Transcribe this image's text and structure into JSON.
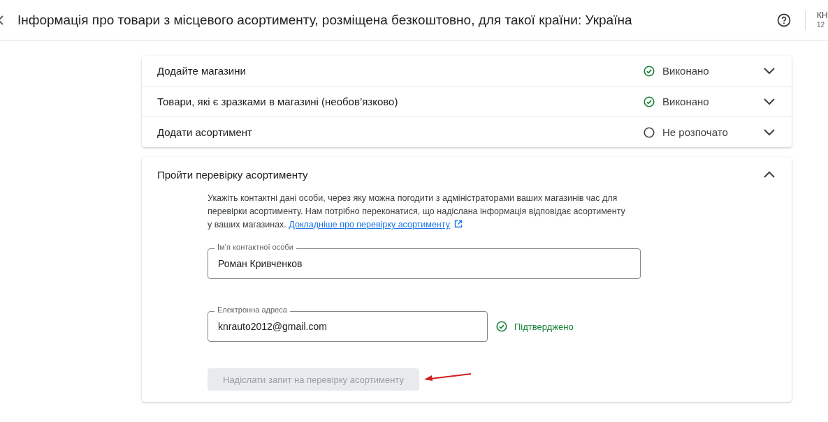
{
  "header": {
    "title": "Інформація про товари з місцевого асортименту, розміщена безкоштовно, для такої країни: Україна",
    "account_name": "КН",
    "account_sub": "12"
  },
  "steps": [
    {
      "title": "Додайте магазини",
      "status": "Виконано",
      "kind": "done",
      "expanded": false
    },
    {
      "title": "Товари, які є зразками в магазині (необов’язково)",
      "status": "Виконано",
      "kind": "done",
      "expanded": false
    },
    {
      "title": "Додати асортимент",
      "status": "Не розпочато",
      "kind": "not_started",
      "expanded": false
    }
  ],
  "verification": {
    "title": "Пройти перевірку асортименту",
    "expanded": true,
    "description": "Укажіть контактні дані особи, через яку можна погодити з адміністраторами ваших магазинів час для перевірки асортименту. Нам потрібно переконатися, що надіслана інформація відповідає асортименту у ваших магазинах.",
    "link": "Докладніше про перевірку асортименту",
    "name_field": {
      "label": "Ім’я контактної особи",
      "value": "Роман Кривченков"
    },
    "email_field": {
      "label": "Електронна адреса",
      "value": "knrauto2012@gmail.com",
      "verified": true,
      "verified_text": "Підтверджено"
    },
    "submit": {
      "label": "Надіслати запит на перевірку асортименту",
      "disabled": true
    }
  }
}
